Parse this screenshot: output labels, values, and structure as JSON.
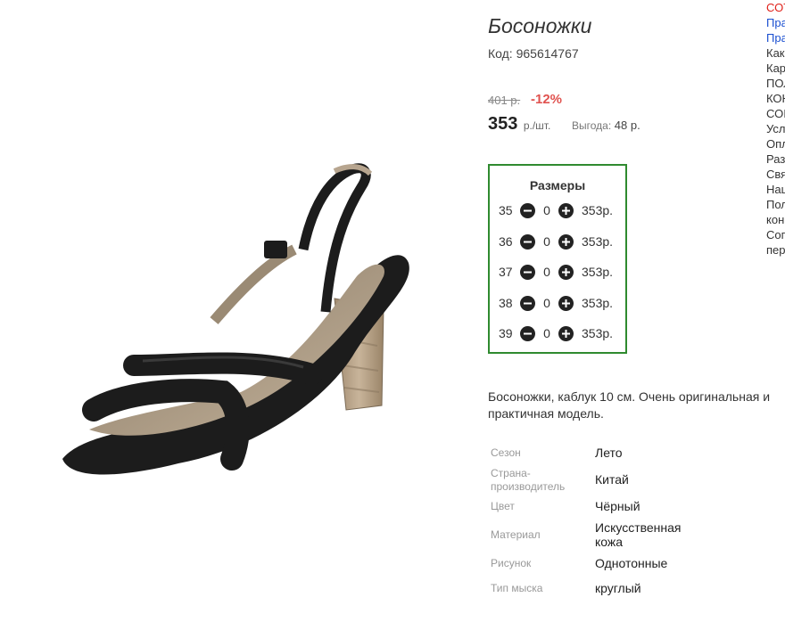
{
  "product": {
    "title": "Босоножки",
    "code": "Код: 965614767",
    "old_price": "401 р.",
    "discount": "-12%",
    "price": "353",
    "price_unit": "р./шт.",
    "benefit_label": "Выгода:",
    "benefit_value": "48 р."
  },
  "sizes": {
    "title": "Размеры",
    "rows": [
      {
        "size": "35",
        "qty": "0",
        "price": "353р."
      },
      {
        "size": "36",
        "qty": "0",
        "price": "353р."
      },
      {
        "size": "37",
        "qty": "0",
        "price": "353р."
      },
      {
        "size": "38",
        "qty": "0",
        "price": "353р."
      },
      {
        "size": "39",
        "qty": "0",
        "price": "353р."
      }
    ]
  },
  "description": "Босоножки, каблук 10 см. Очень оригинальная и практичная модель.",
  "attributes": [
    {
      "label": "Сезон",
      "value": "Лето"
    },
    {
      "label": "Страна-производитель",
      "value": "Китай"
    },
    {
      "label": "Цвет",
      "value": "Чёрный"
    },
    {
      "label": "Материал",
      "value": "Искусственная кожа"
    },
    {
      "label": "Рисунок",
      "value": "Однотонные"
    },
    {
      "label": "Тип мыска",
      "value": "круглый"
    }
  ],
  "right_column": {
    "items": [
      "СОТ",
      "Пра",
      "Пра",
      "Как",
      "Кар",
      "ПОЛ",
      "КОН",
      "СОІ",
      "Усл",
      "Опл",
      "Раз",
      "Свя",
      "Наш",
      "Пол",
      "кон",
      "Сог",
      "пер"
    ],
    "colors": [
      "#e0211a",
      "#1a4fd0",
      "#1a4fd0",
      "#333333",
      "#333333",
      "#333333",
      "#333333",
      "#333333",
      "#333333",
      "#333333",
      "#333333",
      "#333333",
      "#333333",
      "#333333",
      "#333333",
      "#333333",
      "#333333"
    ]
  },
  "colors": {
    "discount": "#e0524f",
    "sizes_border": "#2f8a2f",
    "link": "#1a4fd0",
    "alert": "#e0211a"
  }
}
